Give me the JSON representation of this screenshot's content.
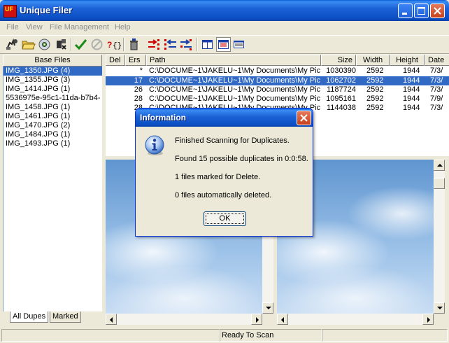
{
  "window": {
    "title": "Unique Filer",
    "logo_text": "UF",
    "logo_subtext": ""
  },
  "menu": [
    "File",
    "View",
    "File Management",
    "Help"
  ],
  "toolbar": {
    "icons": [
      "scan-icon",
      "open-folder-icon",
      "cd-icon",
      "settings-icon",
      "check-icon",
      "cancel-icon",
      "help-icon",
      "delete-icon",
      "move-right-icon",
      "move-left-icon",
      "move-both-icon",
      "single-pane-icon",
      "dual-pane-icon",
      "list-view-icon"
    ]
  },
  "left_panel": {
    "header": "Base Files",
    "items": [
      "IMG_1350.JPG (4)",
      "IMG_1355.JPG (3)",
      "IMG_1414.JPG (1)",
      "5536975e-95c1-11da-b7b4-",
      "IMG_1458.JPG (1)",
      "IMG_1461.JPG (1)",
      "IMG_1470.JPG (2)",
      "IMG_1484.JPG (1)",
      "IMG_1493.JPG (1)"
    ],
    "selected_index": 0,
    "tabs": [
      "All Dupes",
      "Marked"
    ]
  },
  "grid": {
    "columns": [
      "Del",
      "Ers",
      "Path",
      "Size",
      "Width",
      "Height",
      "Date"
    ],
    "rows": [
      {
        "del": "",
        "ers": "*",
        "path": "C:\\DOCUME~1\\JAKELU~1\\My Documents\\My Pict",
        "size": "1030390",
        "width": "2592",
        "height": "1944",
        "date": "7/3/"
      },
      {
        "del": "",
        "ers": "17",
        "path": "C:\\DOCUME~1\\JAKELU~1\\My Documents\\My Pict",
        "size": "1062702",
        "width": "2592",
        "height": "1944",
        "date": "7/3/"
      },
      {
        "del": "",
        "ers": "26",
        "path": "C:\\DOCUME~1\\JAKELU~1\\My Documents\\My Pict",
        "size": "1187724",
        "width": "2592",
        "height": "1944",
        "date": "7/3/"
      },
      {
        "del": "",
        "ers": "28",
        "path": "C:\\DOCUME~1\\JAKELU~1\\My Documents\\My Pict",
        "size": "1095161",
        "width": "2592",
        "height": "1944",
        "date": "7/9/"
      },
      {
        "del": "",
        "ers": "28",
        "path": "C:\\DOCUME~1\\JAKELU~1\\My Documents\\My Pict",
        "size": "1144038",
        "width": "2592",
        "height": "1944",
        "date": "7/3/"
      }
    ],
    "selected_index": 1
  },
  "status": {
    "left": "",
    "center": "Ready To Scan",
    "right": ""
  },
  "dialog": {
    "title": "Information",
    "icon": "info-icon",
    "lines": [
      "Finished Scanning for Duplicates.",
      "Found 15 possible duplicates in 0:0:58.",
      "1 files marked for Delete.",
      "0 files automatically deleted."
    ],
    "ok_label": "OK"
  },
  "colors": {
    "titlebar": "#0b4ec4",
    "selection": "#316ac5",
    "face": "#ece9d8"
  }
}
